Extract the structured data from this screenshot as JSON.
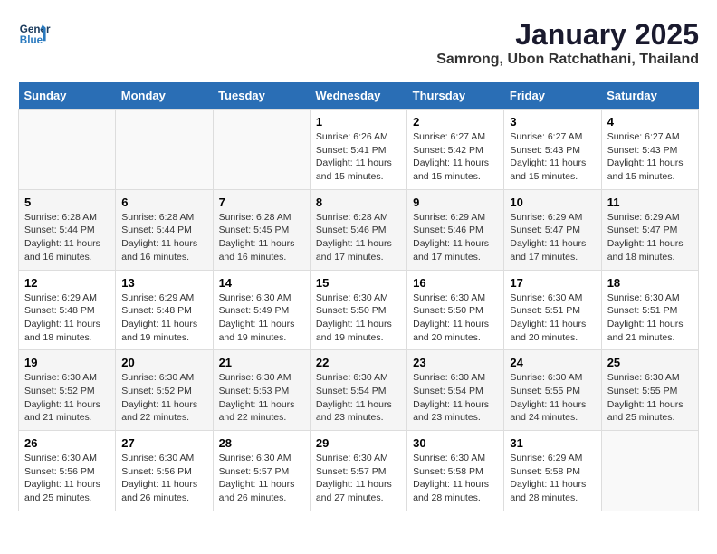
{
  "header": {
    "logo_line1": "General",
    "logo_line2": "Blue",
    "title": "January 2025",
    "subtitle": "Samrong, Ubon Ratchathani, Thailand"
  },
  "days_of_week": [
    "Sunday",
    "Monday",
    "Tuesday",
    "Wednesday",
    "Thursday",
    "Friday",
    "Saturday"
  ],
  "weeks": [
    [
      {
        "day": "",
        "content": ""
      },
      {
        "day": "",
        "content": ""
      },
      {
        "day": "",
        "content": ""
      },
      {
        "day": "1",
        "content": "Sunrise: 6:26 AM\nSunset: 5:41 PM\nDaylight: 11 hours\nand 15 minutes."
      },
      {
        "day": "2",
        "content": "Sunrise: 6:27 AM\nSunset: 5:42 PM\nDaylight: 11 hours\nand 15 minutes."
      },
      {
        "day": "3",
        "content": "Sunrise: 6:27 AM\nSunset: 5:43 PM\nDaylight: 11 hours\nand 15 minutes."
      },
      {
        "day": "4",
        "content": "Sunrise: 6:27 AM\nSunset: 5:43 PM\nDaylight: 11 hours\nand 15 minutes."
      }
    ],
    [
      {
        "day": "5",
        "content": "Sunrise: 6:28 AM\nSunset: 5:44 PM\nDaylight: 11 hours\nand 16 minutes."
      },
      {
        "day": "6",
        "content": "Sunrise: 6:28 AM\nSunset: 5:44 PM\nDaylight: 11 hours\nand 16 minutes."
      },
      {
        "day": "7",
        "content": "Sunrise: 6:28 AM\nSunset: 5:45 PM\nDaylight: 11 hours\nand 16 minutes."
      },
      {
        "day": "8",
        "content": "Sunrise: 6:28 AM\nSunset: 5:46 PM\nDaylight: 11 hours\nand 17 minutes."
      },
      {
        "day": "9",
        "content": "Sunrise: 6:29 AM\nSunset: 5:46 PM\nDaylight: 11 hours\nand 17 minutes."
      },
      {
        "day": "10",
        "content": "Sunrise: 6:29 AM\nSunset: 5:47 PM\nDaylight: 11 hours\nand 17 minutes."
      },
      {
        "day": "11",
        "content": "Sunrise: 6:29 AM\nSunset: 5:47 PM\nDaylight: 11 hours\nand 18 minutes."
      }
    ],
    [
      {
        "day": "12",
        "content": "Sunrise: 6:29 AM\nSunset: 5:48 PM\nDaylight: 11 hours\nand 18 minutes."
      },
      {
        "day": "13",
        "content": "Sunrise: 6:29 AM\nSunset: 5:48 PM\nDaylight: 11 hours\nand 19 minutes."
      },
      {
        "day": "14",
        "content": "Sunrise: 6:30 AM\nSunset: 5:49 PM\nDaylight: 11 hours\nand 19 minutes."
      },
      {
        "day": "15",
        "content": "Sunrise: 6:30 AM\nSunset: 5:50 PM\nDaylight: 11 hours\nand 19 minutes."
      },
      {
        "day": "16",
        "content": "Sunrise: 6:30 AM\nSunset: 5:50 PM\nDaylight: 11 hours\nand 20 minutes."
      },
      {
        "day": "17",
        "content": "Sunrise: 6:30 AM\nSunset: 5:51 PM\nDaylight: 11 hours\nand 20 minutes."
      },
      {
        "day": "18",
        "content": "Sunrise: 6:30 AM\nSunset: 5:51 PM\nDaylight: 11 hours\nand 21 minutes."
      }
    ],
    [
      {
        "day": "19",
        "content": "Sunrise: 6:30 AM\nSunset: 5:52 PM\nDaylight: 11 hours\nand 21 minutes."
      },
      {
        "day": "20",
        "content": "Sunrise: 6:30 AM\nSunset: 5:52 PM\nDaylight: 11 hours\nand 22 minutes."
      },
      {
        "day": "21",
        "content": "Sunrise: 6:30 AM\nSunset: 5:53 PM\nDaylight: 11 hours\nand 22 minutes."
      },
      {
        "day": "22",
        "content": "Sunrise: 6:30 AM\nSunset: 5:54 PM\nDaylight: 11 hours\nand 23 minutes."
      },
      {
        "day": "23",
        "content": "Sunrise: 6:30 AM\nSunset: 5:54 PM\nDaylight: 11 hours\nand 23 minutes."
      },
      {
        "day": "24",
        "content": "Sunrise: 6:30 AM\nSunset: 5:55 PM\nDaylight: 11 hours\nand 24 minutes."
      },
      {
        "day": "25",
        "content": "Sunrise: 6:30 AM\nSunset: 5:55 PM\nDaylight: 11 hours\nand 25 minutes."
      }
    ],
    [
      {
        "day": "26",
        "content": "Sunrise: 6:30 AM\nSunset: 5:56 PM\nDaylight: 11 hours\nand 25 minutes."
      },
      {
        "day": "27",
        "content": "Sunrise: 6:30 AM\nSunset: 5:56 PM\nDaylight: 11 hours\nand 26 minutes."
      },
      {
        "day": "28",
        "content": "Sunrise: 6:30 AM\nSunset: 5:57 PM\nDaylight: 11 hours\nand 26 minutes."
      },
      {
        "day": "29",
        "content": "Sunrise: 6:30 AM\nSunset: 5:57 PM\nDaylight: 11 hours\nand 27 minutes."
      },
      {
        "day": "30",
        "content": "Sunrise: 6:30 AM\nSunset: 5:58 PM\nDaylight: 11 hours\nand 28 minutes."
      },
      {
        "day": "31",
        "content": "Sunrise: 6:29 AM\nSunset: 5:58 PM\nDaylight: 11 hours\nand 28 minutes."
      },
      {
        "day": "",
        "content": ""
      }
    ]
  ]
}
